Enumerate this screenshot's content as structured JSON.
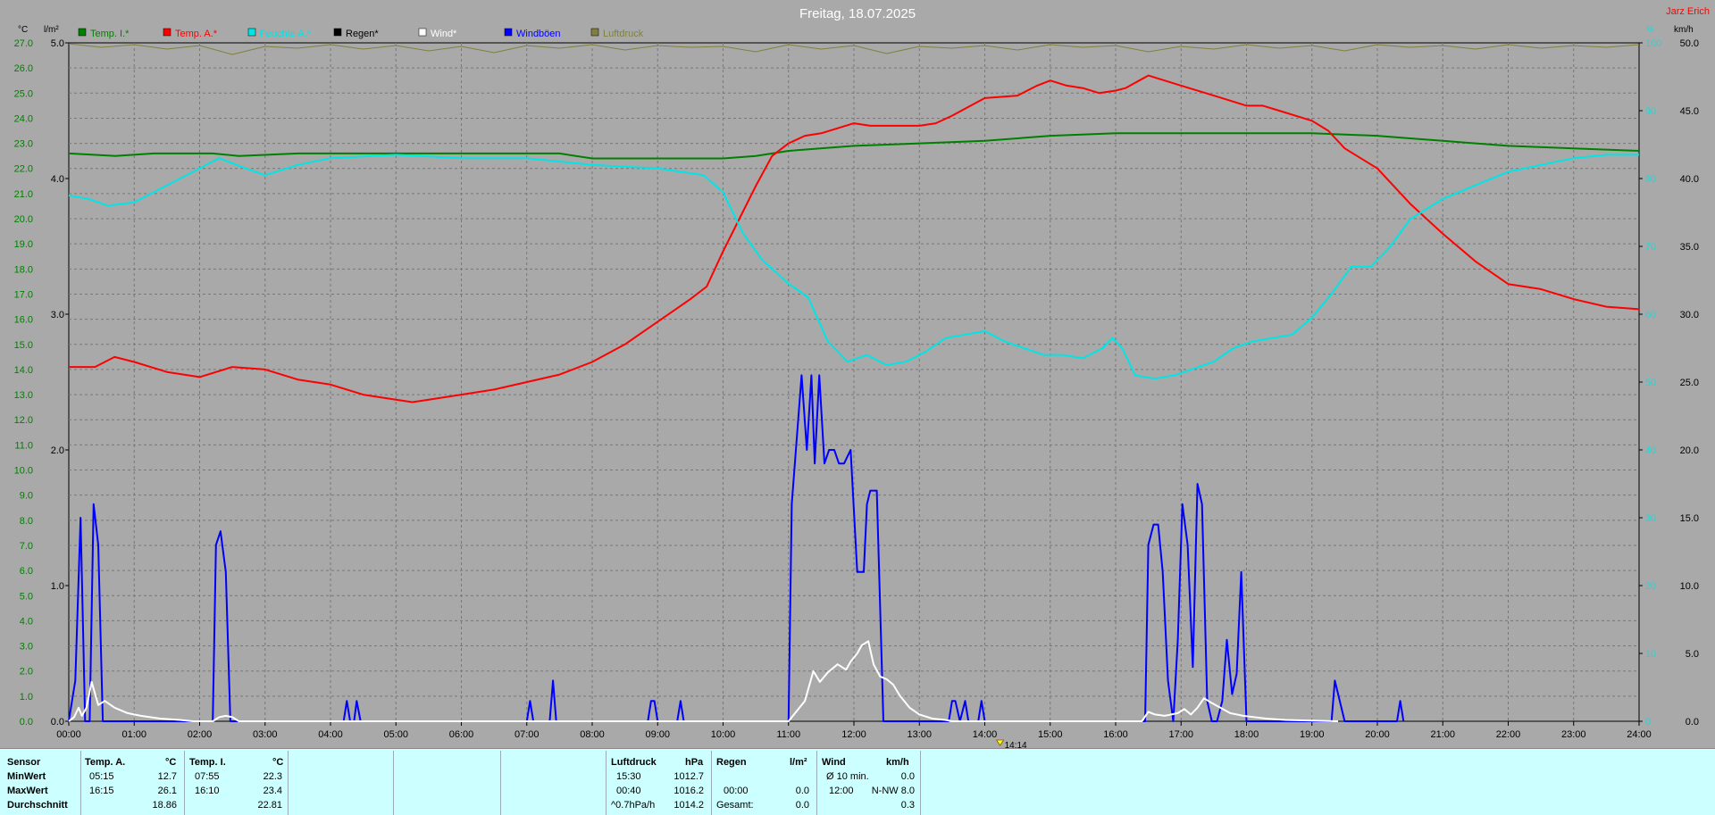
{
  "title": "Freitag, 18.07.2025",
  "author": "Jarz Erich",
  "units": {
    "left1": "°C",
    "left2": "l/m²",
    "right1": "%",
    "right2": "km/h"
  },
  "legend": [
    {
      "label": "Temp. I.*",
      "color": "#008000"
    },
    {
      "label": "Temp. A.*",
      "color": "#ff0000"
    },
    {
      "label": "Feuchte A.*",
      "color": "#00e5e5"
    },
    {
      "label": "Regen*",
      "color": "#000000"
    },
    {
      "label": "Wind*",
      "color": "#ffffff"
    },
    {
      "label": "Windböen",
      "color": "#0000ff"
    },
    {
      "label": "Luftdruck",
      "color": "#808040"
    }
  ],
  "marker": "14:14",
  "chart_data": {
    "type": "line",
    "x_label_ticks": [
      "00:00",
      "01:00",
      "02:00",
      "03:00",
      "04:00",
      "05:00",
      "06:00",
      "07:00",
      "08:00",
      "09:00",
      "10:00",
      "11:00",
      "12:00",
      "13:00",
      "14:00",
      "15:00",
      "16:00",
      "17:00",
      "18:00",
      "19:00",
      "20:00",
      "21:00",
      "22:00",
      "23:00",
      "24:00"
    ],
    "xlim": [
      0,
      24
    ],
    "axes": {
      "temp": {
        "ylim": [
          0,
          27
        ],
        "ticks": [
          "0.0",
          "1.0",
          "2.0",
          "3.0",
          "4.0",
          "5.0",
          "6.0",
          "7.0",
          "8.0",
          "9.0",
          "10.0",
          "11.0",
          "12.0",
          "13.0",
          "14.0",
          "15.0",
          "16.0",
          "17.0",
          "18.0",
          "19.0",
          "20.0",
          "21.0",
          "22.0",
          "23.0",
          "24.0",
          "25.0",
          "26.0",
          "27.0"
        ]
      },
      "rain": {
        "ylim": [
          0,
          5
        ],
        "ticks": [
          "0.0",
          "1.0",
          "2.0",
          "3.0",
          "4.0",
          "5.0"
        ]
      },
      "hum": {
        "ylim": [
          0,
          100
        ],
        "ticks": [
          "0",
          "10",
          "20",
          "30",
          "40",
          "50",
          "60",
          "70",
          "80",
          "90",
          "100"
        ]
      },
      "wind": {
        "ylim": [
          0,
          50
        ],
        "ticks": [
          "0.0",
          "5.0",
          "10.0",
          "15.0",
          "20.0",
          "25.0",
          "30.0",
          "35.0",
          "40.0",
          "45.0",
          "50.0"
        ]
      }
    },
    "grid": true,
    "series": [
      {
        "name": "Temp. I.*",
        "axis": "temp",
        "color": "#008000",
        "x": [
          0,
          0.7,
          1.3,
          2.2,
          2.6,
          3.5,
          4.5,
          5.5,
          6.5,
          7.5,
          8,
          9,
          10,
          10.5,
          11,
          12,
          13,
          14,
          15,
          16,
          17,
          18,
          19,
          20,
          20.5,
          21,
          22,
          23,
          24
        ],
        "y": [
          22.6,
          22.5,
          22.6,
          22.6,
          22.5,
          22.6,
          22.6,
          22.6,
          22.6,
          22.6,
          22.4,
          22.4,
          22.4,
          22.5,
          22.7,
          22.9,
          23.0,
          23.1,
          23.3,
          23.4,
          23.4,
          23.4,
          23.4,
          23.3,
          23.2,
          23.1,
          22.9,
          22.8,
          22.7
        ]
      },
      {
        "name": "Temp. A.*",
        "axis": "temp",
        "color": "#ff0000",
        "x": [
          0,
          0.4,
          0.7,
          1.0,
          1.5,
          2.0,
          2.5,
          3.0,
          3.5,
          4.0,
          4.5,
          5.0,
          5.25,
          5.5,
          6.0,
          6.5,
          7.0,
          7.5,
          8.0,
          8.5,
          9.0,
          9.5,
          9.75,
          10.0,
          10.25,
          10.5,
          10.75,
          11.0,
          11.25,
          11.5,
          11.75,
          12.0,
          12.25,
          12.5,
          13.0,
          13.25,
          13.5,
          14.0,
          14.5,
          14.8,
          15.0,
          15.25,
          15.5,
          15.75,
          16.0,
          16.15,
          16.5,
          17.0,
          17.5,
          18.0,
          18.25,
          18.5,
          19.0,
          19.25,
          19.5,
          20.0,
          20.5,
          21.0,
          21.5,
          22.0,
          22.5,
          23.0,
          23.5,
          24.0
        ],
        "y": [
          14.1,
          14.1,
          14.5,
          14.3,
          13.9,
          13.7,
          14.1,
          14.0,
          13.6,
          13.4,
          13.0,
          12.8,
          12.7,
          12.8,
          13.0,
          13.2,
          13.5,
          13.8,
          14.3,
          15.0,
          15.9,
          16.8,
          17.3,
          18.7,
          20.0,
          21.3,
          22.5,
          23.0,
          23.3,
          23.4,
          23.6,
          23.8,
          23.7,
          23.7,
          23.7,
          23.8,
          24.1,
          24.8,
          24.9,
          25.3,
          25.5,
          25.3,
          25.2,
          25.0,
          25.1,
          25.2,
          25.7,
          25.3,
          24.9,
          24.5,
          24.5,
          24.3,
          23.9,
          23.5,
          22.8,
          22.0,
          20.6,
          19.4,
          18.3,
          17.4,
          17.2,
          16.8,
          16.5,
          16.4
        ]
      },
      {
        "name": "Feuchte A.*",
        "axis": "hum",
        "color": "#00e5e5",
        "x": [
          0,
          0.3,
          0.6,
          1.0,
          1.5,
          2.0,
          2.3,
          2.7,
          3.0,
          3.5,
          4.0,
          5.0,
          6.0,
          7.0,
          8.0,
          9.0,
          9.7,
          10.0,
          10.3,
          10.6,
          11.0,
          11.3,
          11.6,
          11.9,
          12.2,
          12.5,
          12.8,
          13.1,
          13.4,
          13.7,
          14.0,
          14.3,
          14.6,
          14.9,
          15.2,
          15.5,
          15.8,
          15.95,
          16.1,
          16.3,
          16.6,
          16.9,
          17.2,
          17.5,
          17.8,
          18.1,
          18.4,
          18.7,
          19.0,
          19.3,
          19.6,
          19.9,
          20.2,
          20.5,
          21.0,
          21.5,
          22.0,
          22.5,
          23.0,
          23.5,
          24.0
        ],
        "y": [
          77.5,
          77.0,
          76.0,
          76.5,
          79.0,
          81.5,
          83.0,
          81.5,
          80.5,
          82.0,
          83.0,
          83.5,
          83.0,
          83.0,
          82.0,
          81.5,
          80.5,
          78.0,
          72.0,
          68.0,
          64.5,
          62.5,
          56.0,
          53.0,
          54.0,
          52.5,
          53.0,
          54.5,
          56.5,
          57.0,
          57.5,
          56.0,
          55.0,
          54.0,
          54.0,
          53.5,
          55.0,
          56.5,
          55.0,
          51.0,
          50.5,
          51.0,
          52.0,
          53.0,
          55.0,
          56.0,
          56.5,
          57.0,
          59.5,
          63.0,
          67.0,
          67.0,
          70.0,
          74.0,
          77.0,
          79.0,
          81.0,
          82.0,
          83.0,
          83.5,
          83.5
        ]
      },
      {
        "name": "Luftdruck",
        "axis": "rel_top",
        "color": "#808040",
        "x": [
          0,
          0.5,
          1,
          1.5,
          2,
          2.5,
          3,
          3.5,
          4,
          4.5,
          5,
          5.5,
          6,
          6.5,
          7,
          7.5,
          8,
          8.5,
          9,
          9.5,
          10,
          10.5,
          11,
          11.5,
          12,
          12.5,
          13,
          13.5,
          14,
          14.5,
          15,
          15.5,
          16,
          16.5,
          17,
          17.5,
          18,
          18.5,
          19,
          19.5,
          20,
          20.5,
          21,
          21.5,
          22,
          22.5,
          23,
          23.5,
          24
        ],
        "y": [
          0,
          4,
          1,
          6,
          2,
          12,
          3,
          5,
          1,
          6,
          2,
          8,
          3,
          10,
          2,
          5,
          1,
          7,
          2,
          4,
          3,
          9,
          1,
          6,
          2,
          11,
          3,
          5,
          2,
          7,
          1,
          4,
          2,
          9,
          3,
          6,
          1,
          5,
          2,
          8,
          1,
          4,
          2,
          6,
          1,
          5,
          2,
          4,
          1
        ]
      },
      {
        "name": "Windböen",
        "axis": "wind",
        "color": "#0000ff",
        "x": [
          0,
          0.1,
          0.18,
          0.25,
          0.32,
          0.38,
          0.45,
          0.52,
          0.6,
          2.2,
          2.25,
          2.32,
          2.4,
          2.47,
          4.2,
          4.25,
          4.3,
          4.36,
          4.4,
          4.46,
          7.0,
          7.05,
          7.1,
          7.35,
          7.4,
          7.45,
          8.85,
          8.9,
          8.95,
          9.0,
          9.3,
          9.35,
          9.4,
          11.0,
          11.05,
          11.2,
          11.28,
          11.35,
          11.4,
          11.47,
          11.55,
          11.62,
          11.7,
          11.77,
          11.85,
          11.95,
          12.05,
          12.15,
          12.2,
          12.25,
          12.35,
          12.45,
          12.55,
          12.62,
          12.65,
          13.45,
          13.5,
          13.55,
          13.62,
          13.7,
          13.75,
          13.9,
          13.95,
          14.0,
          16.45,
          16.5,
          16.58,
          16.65,
          16.72,
          16.8,
          16.88,
          16.95,
          17.02,
          17.1,
          17.18,
          17.25,
          17.32,
          17.4,
          17.47,
          17.55,
          17.63,
          17.7,
          17.78,
          17.85,
          17.92,
          18.0,
          18.05,
          18.1,
          19.3,
          19.35,
          19.5,
          20.3,
          20.35,
          20.4
        ],
        "y": [
          0,
          3,
          15,
          0,
          0,
          16,
          13,
          0,
          0,
          0,
          13,
          14,
          11,
          0,
          0,
          1.5,
          0,
          0,
          1.5,
          0,
          0,
          1.5,
          0,
          0,
          3,
          0,
          0,
          1.5,
          1.5,
          0,
          0,
          1.5,
          0,
          0,
          16,
          25.5,
          20,
          25.5,
          19,
          25.5,
          19,
          20,
          20,
          19,
          19,
          20,
          11,
          11,
          16,
          17,
          17,
          0,
          0,
          0,
          0,
          0,
          1.5,
          1.5,
          0,
          1.5,
          0,
          0,
          1.5,
          0,
          0,
          13,
          14.5,
          14.5,
          11,
          3,
          0,
          6,
          16,
          13,
          4,
          17.5,
          16,
          1.5,
          0,
          0,
          1.5,
          6,
          2,
          3.5,
          11,
          0,
          0,
          0,
          0,
          3,
          0,
          0,
          1.5,
          0
        ]
      },
      {
        "name": "Wind*",
        "axis": "wind",
        "color": "#ffffff",
        "x": [
          0,
          0.08,
          0.15,
          0.2,
          0.27,
          0.35,
          0.45,
          0.55,
          0.7,
          0.9,
          1.1,
          1.4,
          1.7,
          1.9,
          2.2,
          2.3,
          2.4,
          2.5,
          2.6,
          11.0,
          11.25,
          11.38,
          11.48,
          11.6,
          11.75,
          11.88,
          11.95,
          12.05,
          12.12,
          12.22,
          12.3,
          12.4,
          12.5,
          12.6,
          12.7,
          12.85,
          13.0,
          13.2,
          13.4,
          13.5,
          16.4,
          16.5,
          16.6,
          16.75,
          16.85,
          16.95,
          17.05,
          17.15,
          17.25,
          17.35,
          17.45,
          17.6,
          17.75,
          17.95,
          18.3,
          18.6,
          19.0,
          19.4
        ],
        "y": [
          0,
          0.3,
          1.0,
          0.4,
          1.0,
          2.9,
          1.2,
          1.5,
          1.0,
          0.6,
          0.4,
          0.2,
          0.1,
          0,
          0,
          0.3,
          0.4,
          0.3,
          0,
          0,
          1.5,
          3.7,
          2.9,
          3.6,
          4.2,
          3.8,
          4.4,
          5.0,
          5.6,
          5.9,
          4.2,
          3.3,
          3.1,
          2.7,
          1.9,
          1.0,
          0.5,
          0.2,
          0.1,
          0,
          0,
          0.7,
          0.5,
          0.4,
          0.5,
          0.6,
          0.9,
          0.5,
          1.0,
          1.7,
          1.4,
          1.0,
          0.6,
          0.4,
          0.2,
          0.1,
          0.05,
          0
        ]
      }
    ]
  },
  "stats": {
    "header": {
      "sensor": "Sensor",
      "temp_a": "Temp. A.",
      "unit_c1": "°C",
      "temp_i": "Temp. I.",
      "unit_c2": "°C",
      "luftdruck": "Luftdruck",
      "hpa": "hPa",
      "regen": "Regen",
      "lm2": "l/m²",
      "wind": "Wind",
      "kmh": "km/h"
    },
    "rows": [
      {
        "label": "MinWert",
        "ta_time": "05:15",
        "ta_val": "12.7",
        "ti_time": "07:55",
        "ti_val": "22.3",
        "lp_time": "15:30",
        "lp_val": "1012.7",
        "rg_time": "",
        "rg_val": "",
        "w_label": "Ø 10 min.",
        "w_val": "0.0"
      },
      {
        "label": "MaxWert",
        "ta_time": "16:15",
        "ta_val": "26.1",
        "ti_time": "16:10",
        "ti_val": "23.4",
        "lp_time": "00:40",
        "lp_val": "1016.2",
        "rg_time": "00:00",
        "rg_val": "0.0",
        "w_label": "12:00",
        "w_val": "N-NW 8.0"
      },
      {
        "label": "Durchschnitt",
        "ta_time": "",
        "ta_val": "18.86",
        "ti_time": "",
        "ti_val": "22.81",
        "lp_time": "^0.7hPa/h",
        "lp_val": "1014.2",
        "rg_time": "Gesamt:",
        "rg_val": "0.0",
        "w_label": "",
        "w_val": "0.3"
      }
    ]
  }
}
